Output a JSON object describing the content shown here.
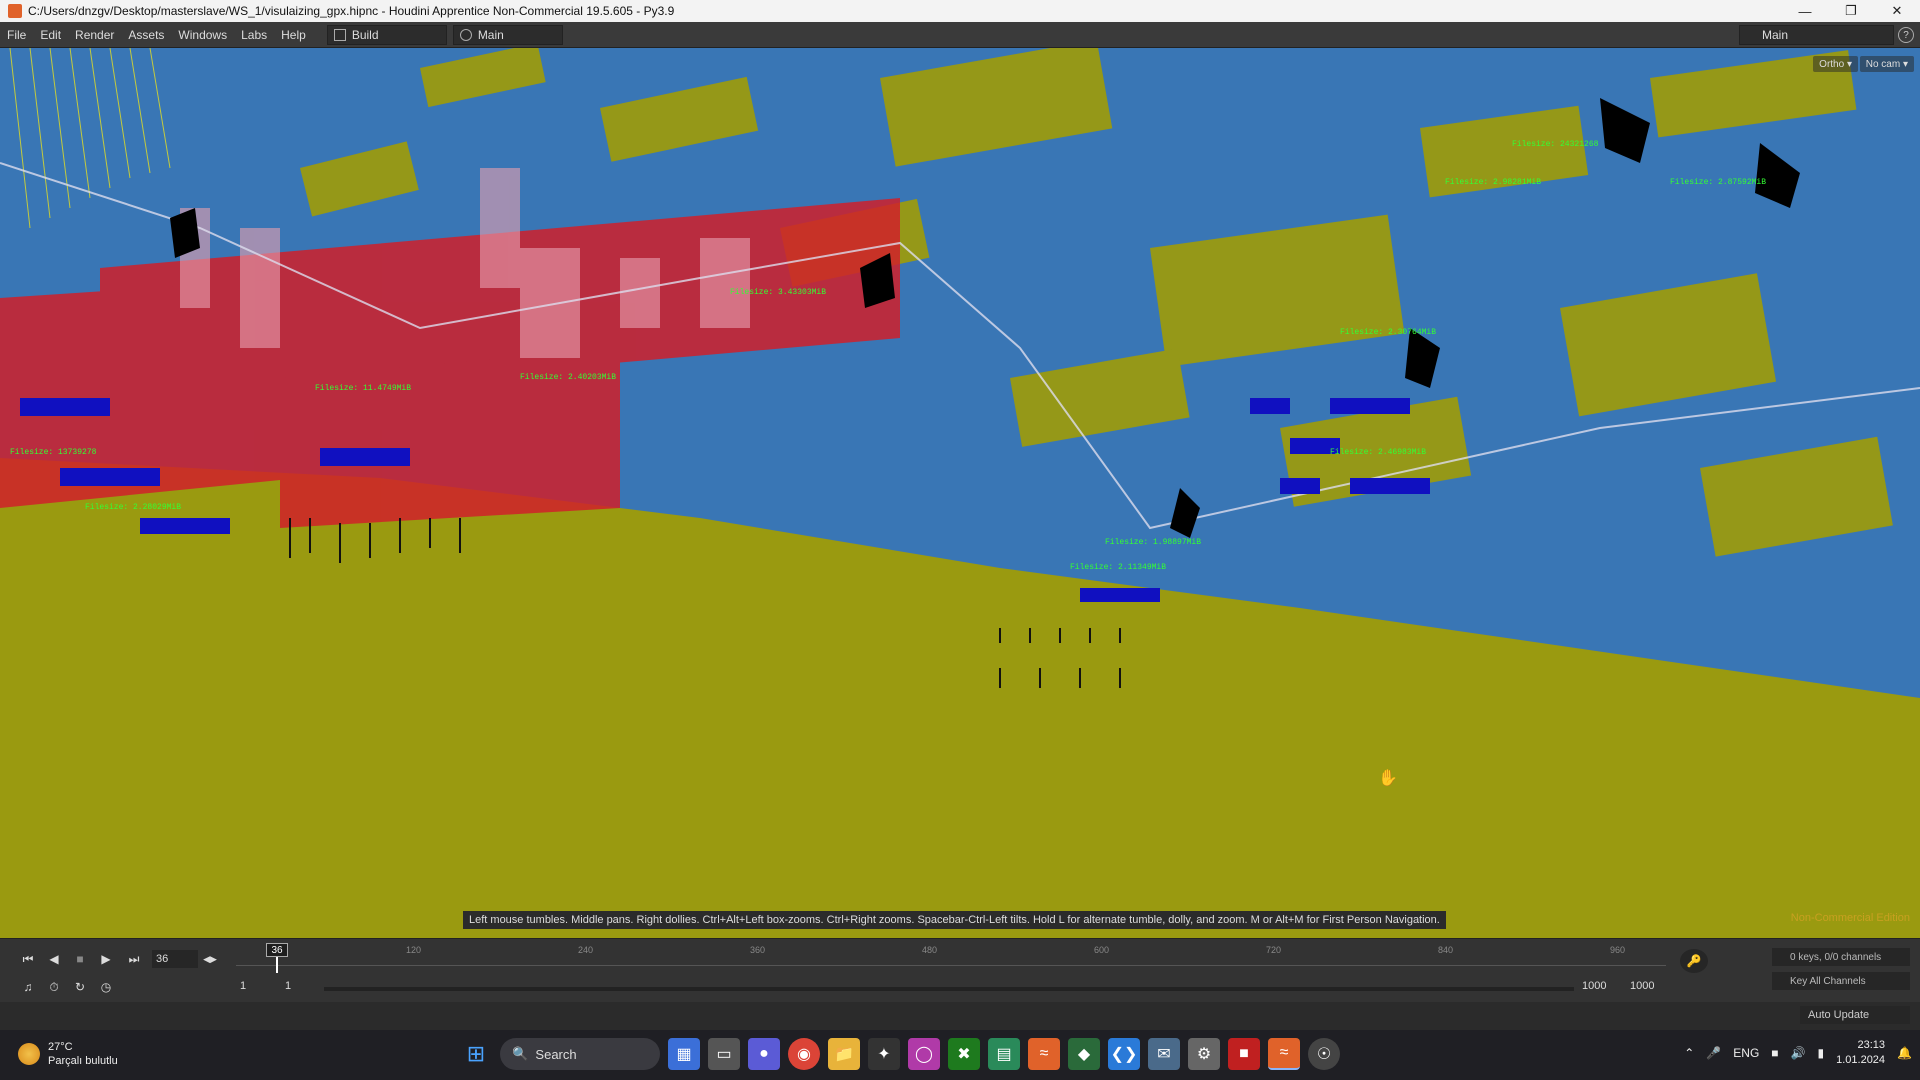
{
  "window": {
    "title": "C:/Users/dnzgv/Desktop/masterslave/WS_1/visulaizing_gpx.hipnc - Houdini Apprentice Non-Commercial 19.5.605 - Py3.9"
  },
  "menubar": {
    "items": [
      "File",
      "Edit",
      "Render",
      "Assets",
      "Windows",
      "Labs",
      "Help"
    ],
    "desktop": "Build",
    "network": "Main",
    "right_desktop": "Main"
  },
  "viewport": {
    "camera_mode": "Ortho",
    "camera": "No cam",
    "hint": "Left mouse tumbles. Middle pans. Right dollies. Ctrl+Alt+Left box-zooms. Ctrl+Right zooms. Spacebar-Ctrl-Left tilts. Hold L for alternate tumble, dolly, and zoom.    M or Alt+M for First Person Navigation.",
    "watermark": "Non-Commercial Edition",
    "colors": {
      "ground": "#9a9a10",
      "buildings_blue": "#2a6fcf",
      "labels_green": "#33ff33",
      "markers_red": "#d0202a"
    },
    "labels": [
      "Filesize: 24321268",
      "Filesize: 2.98281MiB",
      "Filesize: 2.30764MiB",
      "Filesize: 2.46983MiB",
      "Filesize: 11.4749MiB",
      "Filesize: 2.40203MiB",
      "Filesize: 13739278",
      "Filesize: 2.28029MiB",
      "Filesize: 1.98897MiB",
      "Filesize: 2.11349MiB",
      "Filesize: 2.87592MiB",
      "Filesize: 3.43303MiB"
    ]
  },
  "timeline": {
    "current_frame": "36",
    "playhead_label": "36",
    "ticks": [
      "120",
      "240",
      "360",
      "480",
      "600",
      "720",
      "840",
      "960"
    ],
    "range_start": "1",
    "range_start2": "1",
    "range_end": "1000",
    "range_end2": "1000",
    "keys_info": "0 keys, 0/0 channels",
    "key_all": "Key All Channels",
    "auto_update": "Auto Update"
  },
  "taskbar": {
    "weather_temp": "27°C",
    "weather_desc": "Parçalı bulutlu",
    "search": "Search",
    "language": "ENG",
    "time": "23:13",
    "date": "1.01.2024"
  }
}
